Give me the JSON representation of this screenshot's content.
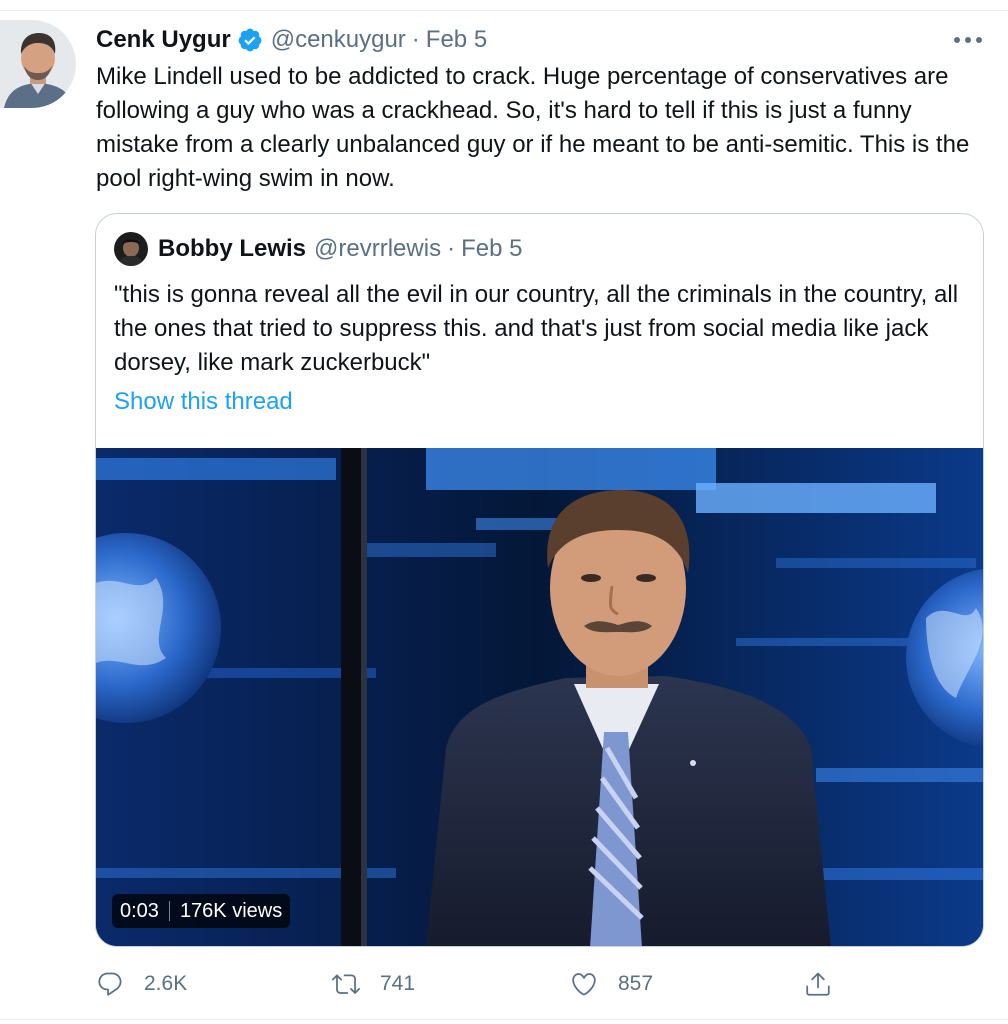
{
  "tweet": {
    "author_name": "Cenk Uygur",
    "author_handle": "@cenkuygur",
    "separator": "·",
    "date": "Feb 5",
    "text": "Mike Lindell used to be addicted to crack. Huge percentage of conservatives are following a guy who was a crackhead. So, it's hard to tell if this is just a funny mistake from a clearly unbalanced guy or if he meant to be anti-semitic. This is the pool right-wing swim in now.",
    "verified_icon": "verified-badge-icon",
    "more_icon": "more-options-icon"
  },
  "quoted": {
    "author_name": "Bobby Lewis",
    "author_handle": "@revrrlewis",
    "separator": "·",
    "date": "Feb 5",
    "text": "\"this is gonna reveal all the evil in our country, all the criminals in the country, all the ones that tried to suppress this. and that's just from social media like jack dorsey, like mark zuckerbuck\"",
    "show_thread": "Show this thread",
    "video": {
      "time": "0:03",
      "views": "176K views"
    }
  },
  "actions": {
    "reply_count": "2.6K",
    "retweet_count": "741",
    "like_count": "857",
    "reply_icon": "reply-icon",
    "retweet_icon": "retweet-icon",
    "like_icon": "heart-icon",
    "share_icon": "share-icon"
  },
  "colors": {
    "link": "#1da1f2",
    "secondary_text": "#5b7083",
    "primary_text": "#0f1419",
    "border": "#c4cfd6"
  }
}
